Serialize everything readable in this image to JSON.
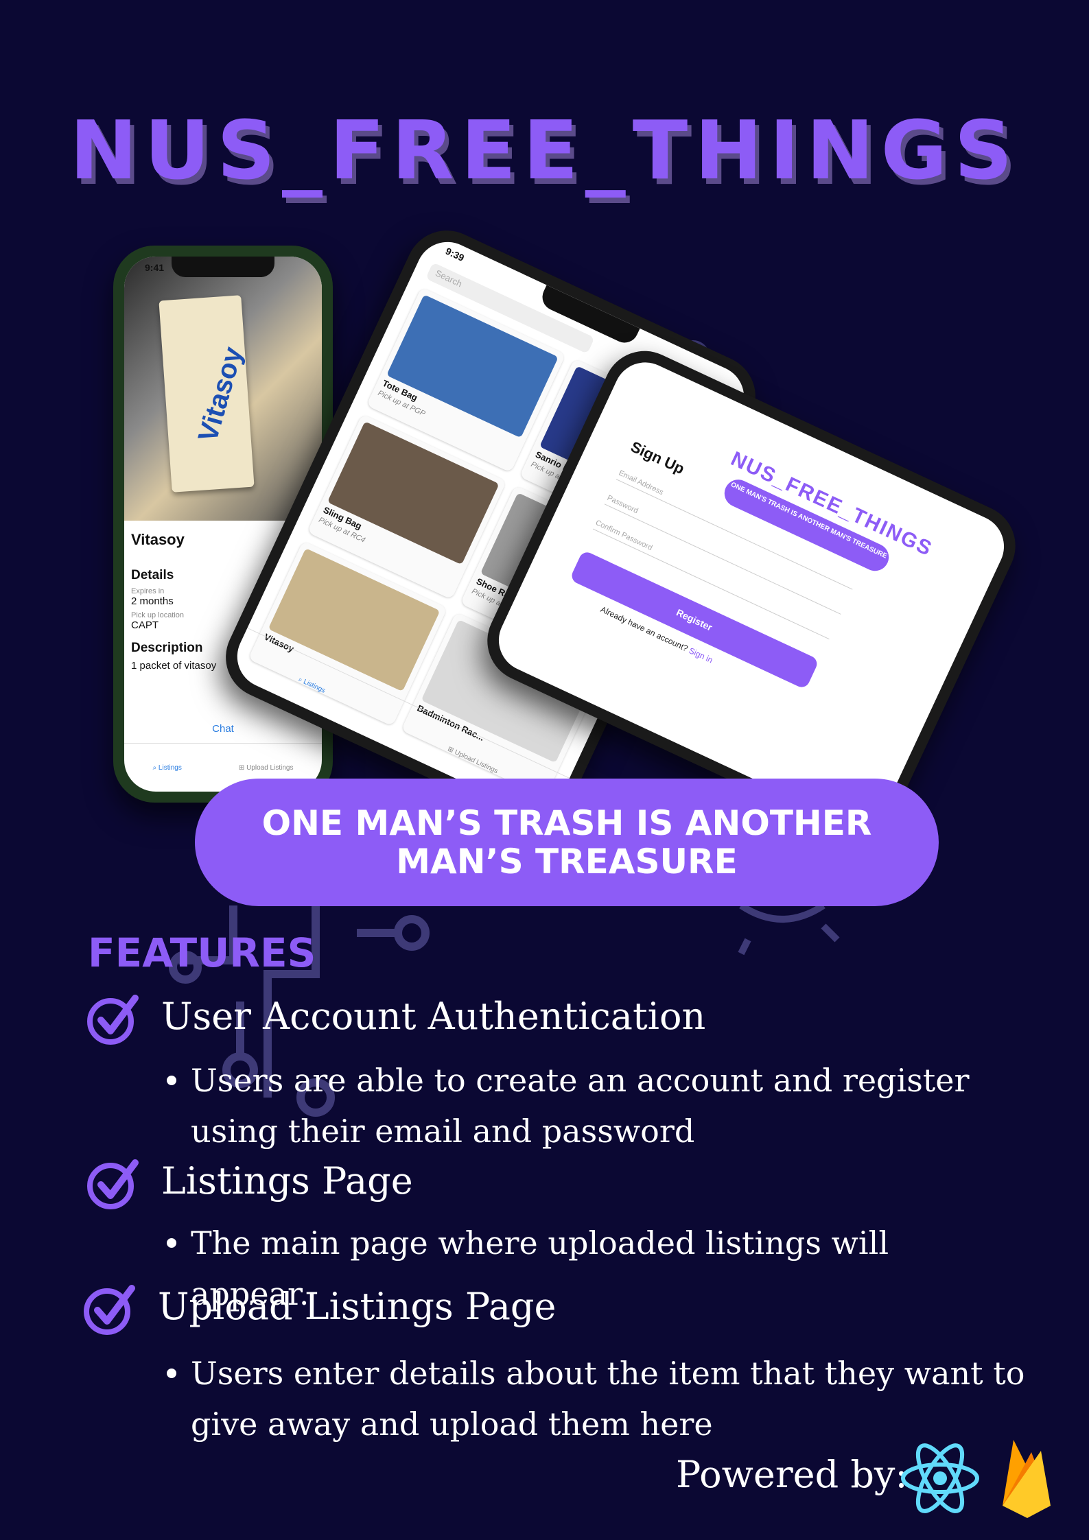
{
  "title": "NUS_FREE_THINGS",
  "tagline": "ONE MAN’S TRASH IS ANOTHER MAN’S TREASURE",
  "phone_detail": {
    "time": "9:41",
    "item_name": "Vitasoy",
    "details_heading": "Details",
    "expires_label": "Expires in",
    "expires_value": "2 months",
    "pickup_label": "Pick up location",
    "pickup_value": "CAPT",
    "description_heading": "Description",
    "description_value": "1 packet of vitasoy",
    "chat_label": "Chat",
    "tab_listings": "Listings",
    "tab_upload": "Upload Listings"
  },
  "phone_listings": {
    "time": "9:39",
    "search_placeholder": "Search",
    "cards": [
      {
        "name": "Tote Bag",
        "pickup": "Pick up at PGP",
        "color": "#3d6fb5"
      },
      {
        "name": "Sanrio Lamp",
        "pickup": "Pick up at KR Hall",
        "color": "#283a8a"
      },
      {
        "name": "Sling Bag",
        "pickup": "Pick up at RC4",
        "color": "#6b5a4a"
      },
      {
        "name": "Shoe Rack",
        "pickup": "Pick up at Tembusu",
        "color": "#9a9a9a"
      },
      {
        "name": "Vitasoy",
        "pickup": "",
        "color": "#c9b58c"
      },
      {
        "name": "Badminton Rac...",
        "pickup": "",
        "color": "#d9d9d9"
      }
    ],
    "tab_listings": "Listings",
    "tab_upload": "Upload Listings"
  },
  "phone_signup": {
    "logo": "NUS_FREE_THINGS",
    "tagline": "ONE MAN'S TRASH IS ANOTHER MAN'S TREASURE",
    "heading": "Sign Up",
    "email_placeholder": "Email Address",
    "password_placeholder": "Password",
    "confirm_placeholder": "Confirm Password",
    "register_label": "Register",
    "already_text": "Already have an account?",
    "signin_label": "Sign in"
  },
  "features": {
    "heading": "FEATURES",
    "items": [
      {
        "title": "User Account Authentication",
        "body": "Users are able to create an account and register using their email and password"
      },
      {
        "title": "Listings Page",
        "body": "The main page where uploaded listings will appear."
      },
      {
        "title": "Upload Listings Page",
        "body": "Users enter details about the item that they want to give away and upload them here"
      }
    ]
  },
  "powered_by": "Powered by:",
  "icons": [
    "check-icon",
    "react-icon",
    "firebase-icon"
  ],
  "colors": {
    "background": "#0b0833",
    "accent": "#8d5cf6"
  }
}
